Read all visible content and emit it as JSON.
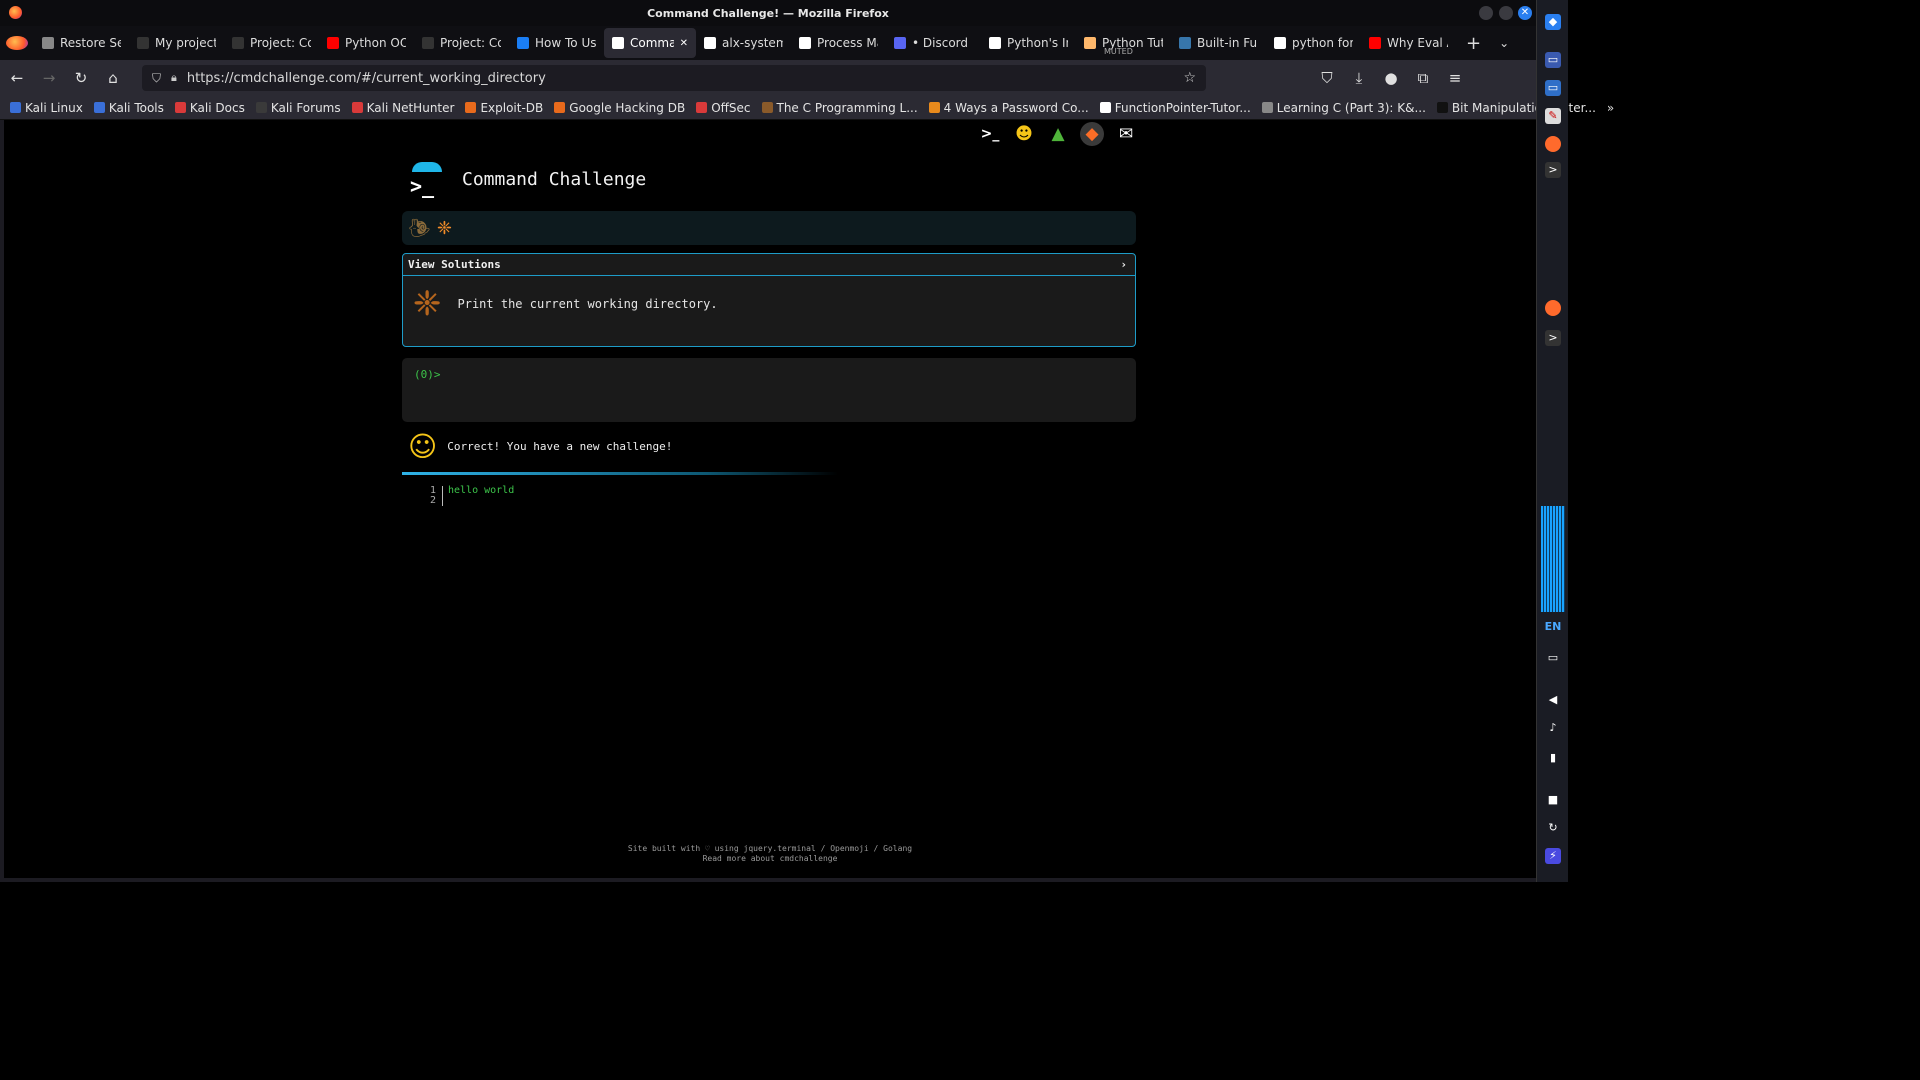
{
  "window": {
    "title": "Command Challenge! — Mozilla Firefox"
  },
  "tabs": [
    {
      "label": "Restore Se",
      "icon": "info-icon",
      "color": "#888888"
    },
    {
      "label": "My projects",
      "icon": "page-icon",
      "color": "#333333"
    },
    {
      "label": "Project: Co",
      "icon": "page-icon",
      "color": "#333333"
    },
    {
      "label": "Python OO",
      "icon": "youtube-icon",
      "color": "#ff0000"
    },
    {
      "label": "Project: Co",
      "icon": "page-icon",
      "color": "#333333"
    },
    {
      "label": "How To Us",
      "icon": "digitalocean-icon",
      "color": "#1a7ef5"
    },
    {
      "label": "Comman",
      "icon": "terminal-icon",
      "color": "#ffffff",
      "active": true
    },
    {
      "label": "alx-system",
      "icon": "github-icon",
      "color": "#ffffff"
    },
    {
      "label": "Process Ma",
      "icon": "github-icon",
      "color": "#ffffff"
    },
    {
      "label": "• Discord |",
      "icon": "discord-icon",
      "color": "#5865f2"
    },
    {
      "label": "Python's In",
      "icon": "python-icon",
      "color": "#ffffff"
    },
    {
      "label": "Python Tut",
      "sub": "MUTED",
      "icon": "python-icon",
      "color": "#ffb86b"
    },
    {
      "label": "Built-in Fu",
      "icon": "python-icon",
      "color": "#3776ab"
    },
    {
      "label": "python for",
      "icon": "google-icon",
      "color": "#ffffff"
    },
    {
      "label": "Why Eval A",
      "icon": "youtube-icon",
      "color": "#ff0000"
    }
  ],
  "nav": {
    "url": "https://cmdchallenge.com/#/current_working_directory"
  },
  "bookmarks": [
    {
      "label": "Kali Linux",
      "color": "#3a6fd8"
    },
    {
      "label": "Kali Tools",
      "color": "#3a6fd8"
    },
    {
      "label": "Kali Docs",
      "color": "#d93a3a"
    },
    {
      "label": "Kali Forums",
      "color": "#3a3a3a"
    },
    {
      "label": "Kali NetHunter",
      "color": "#d93a3a"
    },
    {
      "label": "Exploit-DB",
      "color": "#e86a1c"
    },
    {
      "label": "Google Hacking DB",
      "color": "#e86a1c"
    },
    {
      "label": "OffSec",
      "color": "#d93a3a"
    },
    {
      "label": "The C Programming L...",
      "color": "#8a5a2a"
    },
    {
      "label": "4 Ways a Password Co...",
      "color": "#e88a1c"
    },
    {
      "label": "FunctionPointer-Tutor...",
      "color": "#ffffff"
    },
    {
      "label": "Learning C (Part 3): K&...",
      "color": "#888888"
    },
    {
      "label": "Bit Manipulation: Inter...",
      "color": "#111111"
    }
  ],
  "page": {
    "brand_title": "Command Challenge",
    "view_solutions": "View Solutions",
    "view_solutions_chevron": "›",
    "task": "Print the current working directory.",
    "prompt": "(0)>",
    "result": "Correct! You have a new challenge!",
    "editor_lines": [
      {
        "num": "1",
        "text": "hello world"
      },
      {
        "num": "2",
        "text": ""
      }
    ],
    "footer_line1": "Site built with ♡ using jquery.terminal / Openmoji / Golang",
    "footer_line2": "Read more about cmdchallenge"
  },
  "sidepanel": {
    "lang": "EN"
  },
  "colors": {
    "accent": "#1e9cc8",
    "terminal_green": "#3cc44a"
  }
}
